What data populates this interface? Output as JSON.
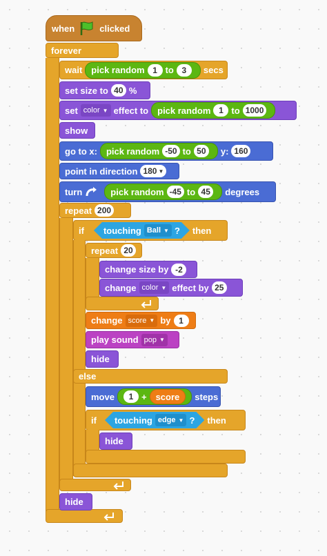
{
  "hat": {
    "when": "when",
    "clicked": "clicked"
  },
  "forever": {
    "label": "forever"
  },
  "wait": {
    "label": "wait",
    "pick": "pick random",
    "from": "1",
    "to_word": "to",
    "to": "3",
    "unit": "secs"
  },
  "set_size": {
    "label": "set size to",
    "value": "40",
    "unit": "%"
  },
  "set_effect": {
    "label": "set",
    "effect": "color",
    "effect_word": "effect to",
    "pick": "pick random",
    "from": "1",
    "to_word": "to",
    "to": "1000"
  },
  "show": {
    "label": "show"
  },
  "goto": {
    "label": "go to x:",
    "pick": "pick random",
    "from": "-50",
    "to_word": "to",
    "to": "50",
    "y_label": "y:",
    "y": "160"
  },
  "point": {
    "label": "point in direction",
    "value": "180"
  },
  "turn": {
    "label": "turn",
    "pick": "pick random",
    "from": "-45",
    "to_word": "to",
    "to": "45",
    "unit": "degrees"
  },
  "repeat_outer": {
    "label": "repeat",
    "count": "200"
  },
  "if1": {
    "label": "if",
    "touching": "touching",
    "target": "Ball",
    "q": "?",
    "then": "then"
  },
  "repeat_inner": {
    "label": "repeat",
    "count": "20"
  },
  "change_size": {
    "label": "change size by",
    "value": "-2"
  },
  "change_effect": {
    "label": "change",
    "effect": "color",
    "effect_word": "effect by",
    "value": "25"
  },
  "change_score": {
    "label": "change",
    "var": "score",
    "by": "by",
    "value": "1"
  },
  "play_sound": {
    "label": "play sound",
    "sound": "pop"
  },
  "hide1": {
    "label": "hide"
  },
  "else": {
    "label": "else"
  },
  "move": {
    "label": "move",
    "a": "1",
    "op": "+",
    "var": "score",
    "unit": "steps"
  },
  "if2": {
    "label": "if",
    "touching": "touching",
    "target": "edge",
    "q": "?",
    "then": "then"
  },
  "hide2": {
    "label": "hide"
  },
  "hide3": {
    "label": "hide"
  },
  "colors": {
    "control": "#e5a52a",
    "motion": "#4a6cd4",
    "looks": "#8a55d7",
    "sound": "#bb42c3",
    "data": "#ee7d16",
    "events": "#c88330",
    "sensing": "#2ca5e2",
    "operators": "#5cb712"
  },
  "icons": [
    "green-flag-icon",
    "turn-right-icon",
    "loop-arrow-icon",
    "dropdown-arrow-icon"
  ]
}
